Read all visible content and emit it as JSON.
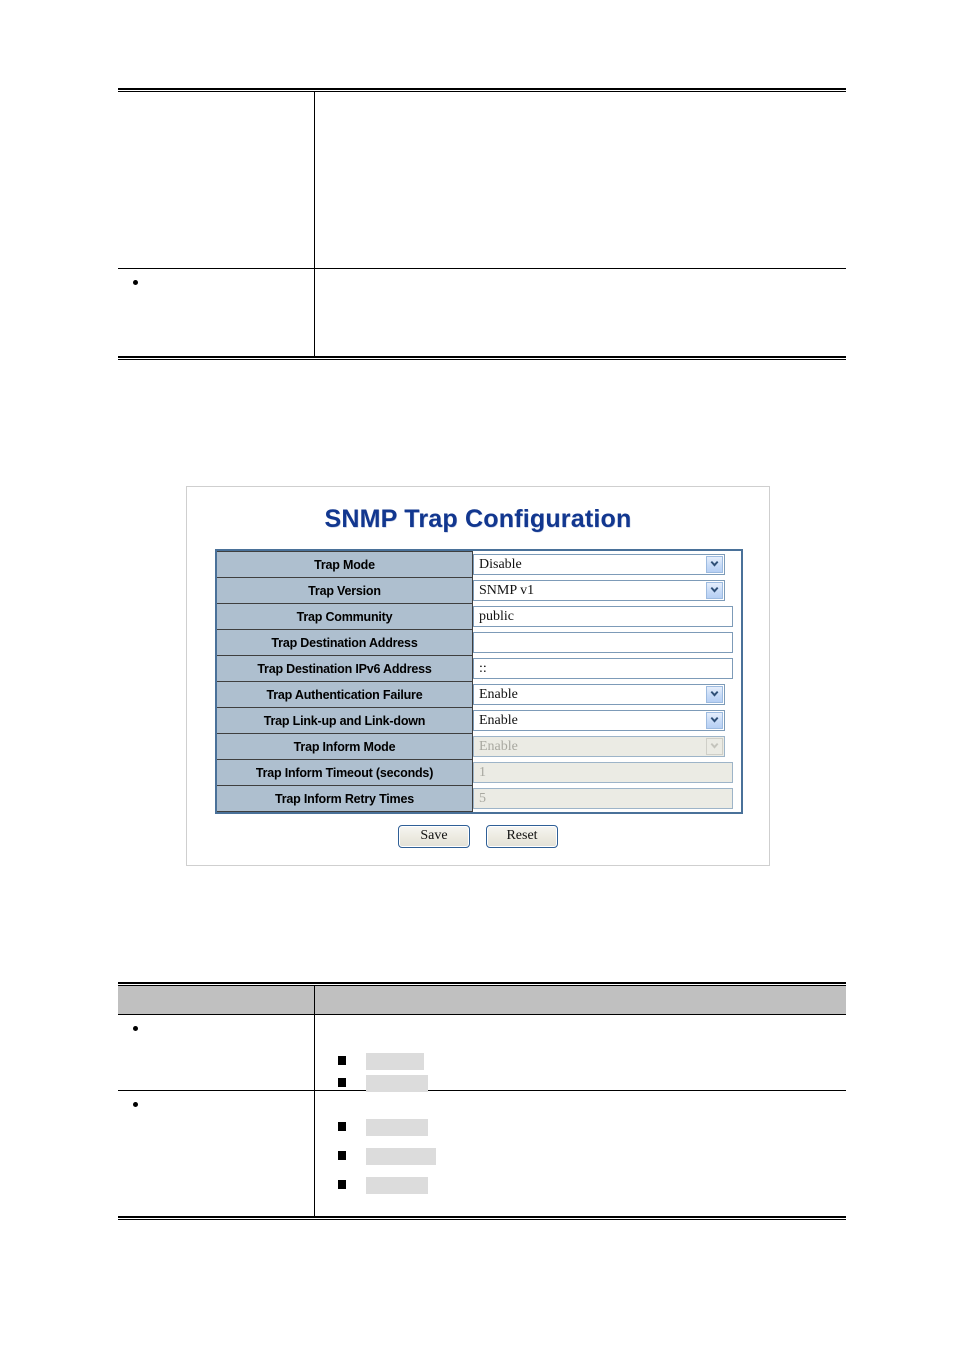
{
  "document": {
    "top_table": {
      "rows": [
        {
          "bullet": false,
          "left_text": "",
          "right_text": ""
        },
        {
          "bullet": true,
          "left_text": "",
          "right_text": ""
        }
      ]
    },
    "bottom_table": {
      "header": {
        "col1": "",
        "col2": ""
      },
      "rows": [
        {
          "bullet": true,
          "left_text": "",
          "sub_items": [
            {
              "marker": "square",
              "text": ""
            },
            {
              "marker": "square",
              "text": ""
            }
          ]
        },
        {
          "bullet": true,
          "left_text": "",
          "sub_items": [
            {
              "marker": "square",
              "text": ""
            },
            {
              "marker": "square",
              "text": ""
            },
            {
              "marker": "square",
              "text": ""
            }
          ]
        }
      ]
    }
  },
  "panel": {
    "title": "SNMP Trap Configuration",
    "title_color": "#12378f",
    "label_bg": "#aebfcf",
    "border_color": "#4a7199",
    "fields": [
      {
        "label": "Trap Mode",
        "control": "select",
        "value": "Disable",
        "disabled": false,
        "icon": "chevron-down-icon"
      },
      {
        "label": "Trap Version",
        "control": "select",
        "value": "SNMP v1",
        "disabled": false,
        "icon": "chevron-down-icon"
      },
      {
        "label": "Trap Community",
        "control": "text",
        "value": "public",
        "disabled": false,
        "icon": ""
      },
      {
        "label": "Trap Destination Address",
        "control": "text",
        "value": "",
        "disabled": false,
        "icon": ""
      },
      {
        "label": "Trap Destination IPv6 Address",
        "control": "text",
        "value": "::",
        "disabled": false,
        "icon": ""
      },
      {
        "label": "Trap Authentication Failure",
        "control": "select",
        "value": "Enable",
        "disabled": false,
        "icon": "chevron-down-icon"
      },
      {
        "label": "Trap Link-up and Link-down",
        "control": "select",
        "value": "Enable",
        "disabled": false,
        "icon": "chevron-down-icon"
      },
      {
        "label": "Trap Inform Mode",
        "control": "select",
        "value": "Enable",
        "disabled": true,
        "icon": "chevron-down-icon"
      },
      {
        "label": "Trap Inform Timeout (seconds)",
        "control": "text",
        "value": "1",
        "disabled": true,
        "icon": ""
      },
      {
        "label": "Trap Inform Retry Times",
        "control": "text",
        "value": "5",
        "disabled": true,
        "icon": ""
      }
    ],
    "buttons": {
      "save_label": "Save",
      "reset_label": "Reset"
    }
  }
}
